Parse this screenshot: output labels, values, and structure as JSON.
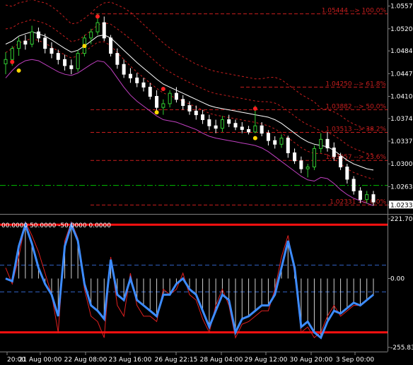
{
  "chart_data": [
    {
      "type": "candlestick",
      "name": "price",
      "ylim": [
        1.0222,
        1.056
      ],
      "y_ticks": [
        "1.05570",
        "1.05200",
        "1.04840",
        "1.04470",
        "1.04100",
        "1.03740",
        "1.03370",
        "1.03000",
        "1.02630",
        "1.02331"
      ],
      "y_tick_values": [
        1.0557,
        1.052,
        1.0484,
        1.0447,
        1.041,
        1.0374,
        1.0337,
        1.03,
        1.0263,
        1.02331
      ],
      "fib_levels": [
        {
          "label": "1.05444 --> 100.0%",
          "value": 1.05444
        },
        {
          "label": "1.04250 --> 61.8%",
          "value": 1.0425
        },
        {
          "label": "1.03882 --> 50.0%",
          "value": 1.03882
        },
        {
          "label": "1.03513 --> 38.2%",
          "value": 1.03513
        },
        {
          "label": "1.03057 --> 23.6%",
          "value": 1.03057
        },
        {
          "label": "1.02331 --> 0.0%",
          "value": 1.02331
        }
      ],
      "fib_label_shown": [
        "1.05444 --> 100.0%",
        "1.04250 --> 61.8%",
        "1.03882 --> 50.0%",
        "1.03513 --> 38.2%",
        "1.03057 --> 23.6%",
        "1.0233",
        "0.0%"
      ],
      "current_price": "1.02331",
      "green_dashdot_level": 1.0265,
      "candles": [
        [
          1.0463,
          1.0482,
          1.0446,
          1.047
        ],
        [
          1.047,
          1.0492,
          1.046,
          1.0488
        ],
        [
          1.0488,
          1.0506,
          1.0476,
          1.05
        ],
        [
          1.05,
          1.051,
          1.0486,
          1.0495
        ],
        [
          1.0495,
          1.0525,
          1.049,
          1.0515
        ],
        [
          1.0515,
          1.0522,
          1.0498,
          1.0505
        ],
        [
          1.0505,
          1.0512,
          1.048,
          1.0488
        ],
        [
          1.0488,
          1.0498,
          1.0472,
          1.048
        ],
        [
          1.048,
          1.0486,
          1.0462,
          1.047
        ],
        [
          1.047,
          1.0478,
          1.0452,
          1.046
        ],
        [
          1.046,
          1.047,
          1.0446,
          1.0455
        ],
        [
          1.0455,
          1.0485,
          1.045,
          1.048
        ],
        [
          1.048,
          1.051,
          1.0475,
          1.0505
        ],
        [
          1.0505,
          1.052,
          1.0495,
          1.0515
        ],
        [
          1.0515,
          1.0545,
          1.051,
          1.053
        ],
        [
          1.053,
          1.054,
          1.05,
          1.0505
        ],
        [
          1.0505,
          1.051,
          1.0475,
          1.048
        ],
        [
          1.048,
          1.0488,
          1.0455,
          1.0462
        ],
        [
          1.0462,
          1.047,
          1.044,
          1.0446
        ],
        [
          1.0446,
          1.0456,
          1.0432,
          1.044
        ],
        [
          1.044,
          1.0448,
          1.0425,
          1.0432
        ],
        [
          1.0432,
          1.044,
          1.0418,
          1.0425
        ],
        [
          1.0425,
          1.0432,
          1.0405,
          1.041
        ],
        [
          1.041,
          1.042,
          1.0385,
          1.0392
        ],
        [
          1.0392,
          1.0405,
          1.038,
          1.0398
        ],
        [
          1.0398,
          1.042,
          1.0392,
          1.0415
        ],
        [
          1.0415,
          1.0425,
          1.04,
          1.0405
        ],
        [
          1.0405,
          1.0412,
          1.0388,
          1.0395
        ],
        [
          1.0395,
          1.0402,
          1.038,
          1.0386
        ],
        [
          1.0386,
          1.0395,
          1.0372,
          1.038
        ],
        [
          1.038,
          1.0388,
          1.0365,
          1.0372
        ],
        [
          1.0372,
          1.038,
          1.0355,
          1.0362
        ],
        [
          1.0362,
          1.0372,
          1.035,
          1.0358
        ],
        [
          1.0358,
          1.0378,
          1.0352,
          1.0372
        ],
        [
          1.0372,
          1.038,
          1.036,
          1.0366
        ],
        [
          1.0366,
          1.0372,
          1.0355,
          1.036
        ],
        [
          1.036,
          1.0368,
          1.035,
          1.0356
        ],
        [
          1.0356,
          1.0362,
          1.0348,
          1.0352
        ],
        [
          1.0352,
          1.0395,
          1.035,
          1.0362
        ],
        [
          1.0362,
          1.0368,
          1.0345,
          1.035
        ],
        [
          1.035,
          1.0355,
          1.033,
          1.0338
        ],
        [
          1.0338,
          1.0345,
          1.0325,
          1.0332
        ],
        [
          1.0332,
          1.0348,
          1.0326,
          1.0342
        ],
        [
          1.0342,
          1.0346,
          1.031,
          1.0318
        ],
        [
          1.0318,
          1.0325,
          1.03,
          1.0305
        ],
        [
          1.0305,
          1.0312,
          1.0285,
          1.0292
        ],
        [
          1.0292,
          1.03,
          1.0278,
          1.0295
        ],
        [
          1.0295,
          1.033,
          1.029,
          1.0325
        ],
        [
          1.0325,
          1.035,
          1.0318,
          1.034
        ],
        [
          1.034,
          1.0352,
          1.032,
          1.0326
        ],
        [
          1.0326,
          1.0335,
          1.0305,
          1.0312
        ],
        [
          1.0312,
          1.0318,
          1.029,
          1.0295
        ],
        [
          1.0295,
          1.03,
          1.0268,
          1.0275
        ],
        [
          1.0275,
          1.028,
          1.025,
          1.0256
        ],
        [
          1.0256,
          1.0262,
          1.0236,
          1.0242
        ],
        [
          1.0242,
          1.0256,
          1.0236,
          1.025
        ],
        [
          1.025,
          1.0256,
          1.0232,
          1.0238
        ]
      ],
      "bands": {
        "white_mid": [
          1.0495,
          1.05,
          1.0508,
          1.0512,
          1.0515,
          1.0512,
          1.0508,
          1.0502,
          1.0495,
          1.0488,
          1.0482,
          1.0485,
          1.0492,
          1.05,
          1.0508,
          1.051,
          1.0505,
          1.0495,
          1.0485,
          1.0475,
          1.0465,
          1.0456,
          1.0447,
          1.0438,
          1.043,
          1.0425,
          1.042,
          1.0415,
          1.041,
          1.0405,
          1.04,
          1.0395,
          1.0392,
          1.039,
          1.0388,
          1.0386,
          1.0384,
          1.0382,
          1.038,
          1.0378,
          1.0376,
          1.0372,
          1.0366,
          1.0358,
          1.035,
          1.0342,
          1.0336,
          1.0332,
          1.033,
          1.0328,
          1.0322,
          1.0314,
          1.0306,
          1.03,
          1.0296,
          1.0292,
          1.029
        ],
        "magenta_lower": [
          1.044,
          1.0452,
          1.0462,
          1.0468,
          1.047,
          1.0468,
          1.0462,
          1.0456,
          1.045,
          1.0446,
          1.0444,
          1.0448,
          1.0455,
          1.0462,
          1.0468,
          1.0466,
          1.0455,
          1.044,
          1.0425,
          1.0412,
          1.0402,
          1.0394,
          1.0386,
          1.0378,
          1.0372,
          1.037,
          1.0368,
          1.0364,
          1.036,
          1.0356,
          1.035,
          1.0345,
          1.0342,
          1.034,
          1.0338,
          1.0336,
          1.0334,
          1.0332,
          1.033,
          1.0326,
          1.032,
          1.0312,
          1.0304,
          1.0296,
          1.0288,
          1.028,
          1.0274,
          1.0272,
          1.0278,
          1.0276,
          1.0268,
          1.0258,
          1.025,
          1.0244,
          1.024,
          1.0236,
          1.0232
        ]
      },
      "signal_dots": {
        "red": [
          [
            1,
            1.0466
          ],
          [
            14,
            1.054
          ],
          [
            24,
            1.0422
          ],
          [
            38,
            1.039
          ]
        ],
        "yellow": [
          [
            2,
            1.0452
          ],
          [
            12,
            1.0492
          ],
          [
            23,
            1.0384
          ],
          [
            38,
            1.0342
          ]
        ]
      }
    },
    {
      "type": "oscillator",
      "name": "cci",
      "header_text": "00.0000 50.0000 -50.0000 0.0000",
      "ylim": [
        -255.83,
        221.71
      ],
      "y_ticks": [
        "221.706",
        "0.00",
        "-255.830"
      ],
      "y_tick_values": [
        221.706,
        0,
        -255.83
      ],
      "levels": {
        "upper_red": 200,
        "lower_red": -200,
        "upper_dash": 50,
        "lower_dash": -50
      },
      "blue_line": [
        0,
        -10,
        120,
        200,
        130,
        40,
        -20,
        -60,
        -140,
        120,
        200,
        140,
        -20,
        -100,
        -120,
        -150,
        70,
        -60,
        -80,
        0,
        -80,
        -100,
        -120,
        -140,
        -60,
        -60,
        -20,
        0,
        -40,
        -60,
        -120,
        -180,
        -120,
        -60,
        -80,
        -200,
        -150,
        -140,
        -120,
        -100,
        -100,
        -60,
        40,
        140,
        40,
        -180,
        -160,
        -200,
        -220,
        -160,
        -120,
        -130,
        -110,
        -90,
        -100,
        -80,
        -60
      ],
      "red_line": [
        40,
        -20,
        80,
        210,
        160,
        100,
        20,
        -60,
        -200,
        140,
        210,
        150,
        -40,
        -140,
        -160,
        -220,
        80,
        -100,
        -140,
        20,
        -100,
        -140,
        -140,
        -160,
        -40,
        -60,
        -40,
        20,
        -60,
        -80,
        -150,
        -200,
        -100,
        -40,
        -100,
        -220,
        -170,
        -160,
        -140,
        -120,
        -120,
        -40,
        80,
        160,
        20,
        -200,
        -180,
        -220,
        -200,
        -140,
        -100,
        -140,
        -120,
        -100,
        -100,
        -80,
        -60
      ]
    }
  ],
  "x_labels": [
    "20:00",
    "21 Aug 00:00",
    "22 Aug 08:00",
    "23 Aug 16:00",
    "26 Aug 22:15",
    "28 Aug 04:00",
    "29 Aug 12:00",
    "30 Aug 20:00",
    "3 Sep 00:00"
  ],
  "colors": {
    "bull": "#32cd32",
    "bear": "#ffffff",
    "grid": "#ff3030",
    "fib": "#c81e1e",
    "band_white": "#ffffff",
    "band_magenta": "#c040c0",
    "cci_blue": "#3d8cff",
    "cci_red": "#e02020",
    "level_red": "#ff1010",
    "dash_blue": "#3060c0",
    "axis_text": "#ffffff",
    "green_dashdot": "#00c000"
  }
}
